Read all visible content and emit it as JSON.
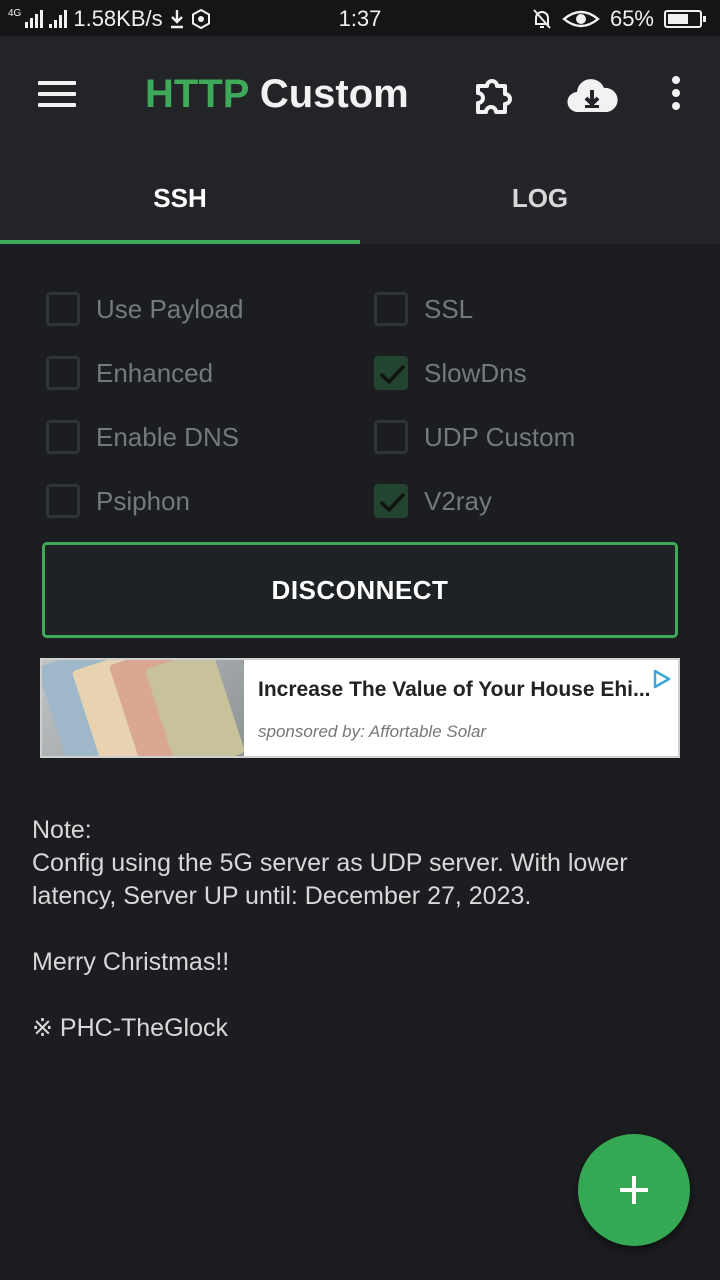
{
  "status_bar": {
    "network_type": "4G",
    "speed": "1.58KB/s",
    "time": "1:37",
    "battery": "65%",
    "battery_level": 0.65
  },
  "app_bar": {
    "title_accent": "HTTP",
    "title_rest": " Custom",
    "icons": [
      "menu-icon",
      "puzzle-icon",
      "cloud-download-icon",
      "more-vert-icon"
    ]
  },
  "tabs": [
    {
      "label": "SSH",
      "active": true
    },
    {
      "label": "LOG",
      "active": false
    }
  ],
  "options": [
    {
      "label": "Use Payload",
      "checked": false
    },
    {
      "label": "SSL",
      "checked": false
    },
    {
      "label": "Enhanced",
      "checked": false
    },
    {
      "label": "SlowDns",
      "checked": true
    },
    {
      "label": "Enable DNS",
      "checked": false
    },
    {
      "label": "UDP Custom",
      "checked": false
    },
    {
      "label": "Psiphon",
      "checked": false
    },
    {
      "label": "V2ray",
      "checked": true
    }
  ],
  "action_button": "DISCONNECT",
  "ad": {
    "headline": "Increase The Value of Your House Ehi...",
    "sponsor": "sponsored by: Affortable Solar"
  },
  "note": {
    "lines": [
      "Note:",
      "Config using the 5G server as UDP server. With lower latency, Server UP until: December 27, 2023.",
      "",
      "Merry Christmas!!",
      "",
      "※ PHC-TheGlock"
    ]
  },
  "colors": {
    "accent": "#3fa95a",
    "background": "#1b1d20",
    "app_bar": "#222428",
    "fab": "#35a853"
  }
}
